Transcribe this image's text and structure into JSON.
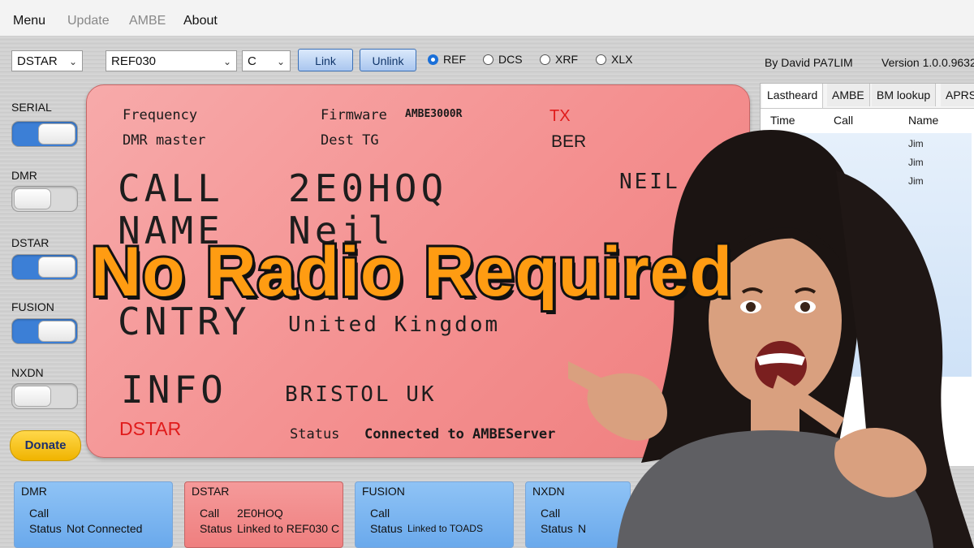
{
  "menu": {
    "items": [
      "Menu",
      "Update",
      "AMBE",
      "About"
    ]
  },
  "toolbar": {
    "mode_select": "DSTAR",
    "reflector_select": "REF030",
    "module_select": "C",
    "link_label": "Link",
    "unlink_label": "Unlink",
    "radios": [
      {
        "label": "REF",
        "selected": true
      },
      {
        "label": "DCS",
        "selected": false
      },
      {
        "label": "XRF",
        "selected": false
      },
      {
        "label": "XLX",
        "selected": false
      }
    ],
    "author": "By David PA7LIM",
    "version": "Version 1.0.0.9632"
  },
  "sidebar": {
    "toggles": [
      {
        "label": "SERIAL",
        "on": true
      },
      {
        "label": "DMR",
        "on": false
      },
      {
        "label": "DSTAR",
        "on": true
      },
      {
        "label": "FUSION",
        "on": true
      },
      {
        "label": "NXDN",
        "on": false
      }
    ],
    "donate_label": "Donate"
  },
  "display": {
    "frequency_label": "Frequency",
    "firmware_label": "Firmware",
    "firmware_value": "AMBE3000R",
    "tx_label": "TX",
    "dmr_master_label": "DMR master",
    "dest_tg_label": "Dest TG",
    "dest_tg_value": "BER",
    "call_label": "CALL",
    "call_value": "2E0HOQ",
    "call_name_right": "NEIL",
    "name_label": "NAME",
    "name_value": "Neil",
    "cntry_label": "CNTRY",
    "cntry_value": "United Kingdom",
    "info_label": "INFO",
    "info_value": "BRISTOL UK",
    "mode_label": "DSTAR",
    "status_label": "Status",
    "status_value": "Connected to AMBEServer",
    "tx_color": "#e01b1b"
  },
  "right_panel": {
    "tabs": [
      "Lastheard",
      "AMBE",
      "BM lookup",
      "APRS"
    ],
    "columns": [
      "Time",
      "Call",
      "Name"
    ],
    "names": [
      "Jim",
      "Jim",
      "Jim"
    ]
  },
  "cards": [
    {
      "title": "DMR",
      "call_label": "Call",
      "call_value": "",
      "status_label": "Status",
      "status_value": "Not Connected"
    },
    {
      "title": "DSTAR",
      "call_label": "Call",
      "call_value": "2E0HOQ",
      "status_label": "Status",
      "status_value": "Linked to REF030 C"
    },
    {
      "title": "FUSION",
      "call_label": "Call",
      "call_value": "",
      "status_label": "Status",
      "status_value": "Linked to TOADS"
    },
    {
      "title": "NXDN",
      "call_label": "Call",
      "call_value": "",
      "status_label": "Status",
      "status_value": "N"
    }
  ],
  "overlay": {
    "headline": "No Radio Required",
    "headline_color": "#ff9c12"
  }
}
